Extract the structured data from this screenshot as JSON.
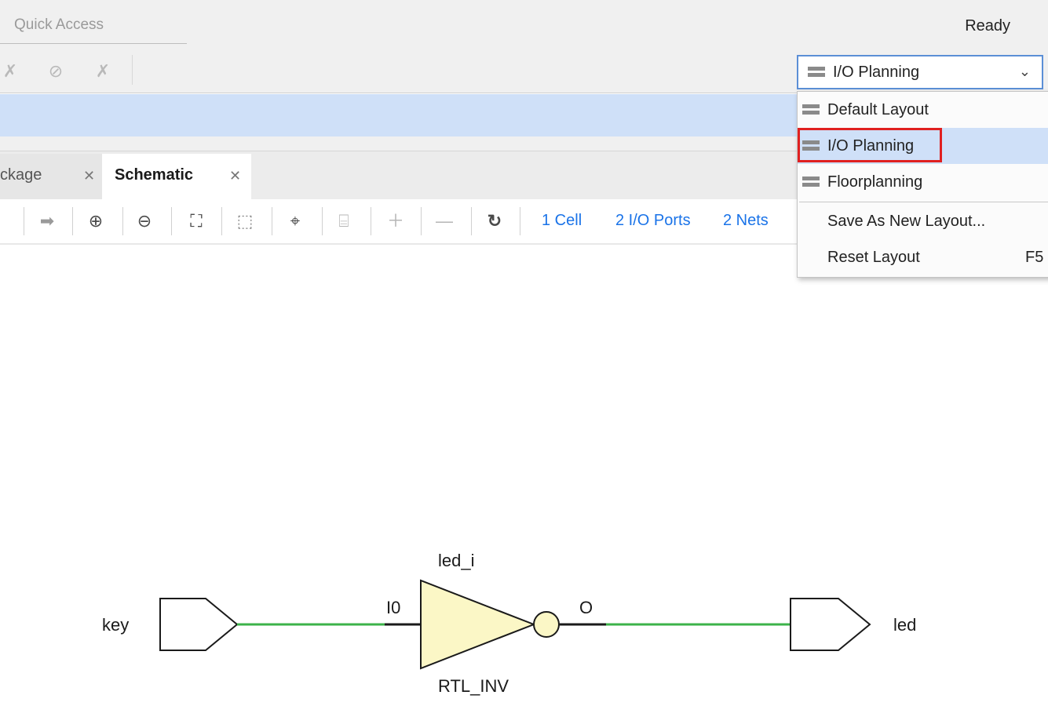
{
  "topbar": {
    "quick_access_placeholder": "Quick Access",
    "status": "Ready"
  },
  "layout_selector": {
    "selected": "I/O Planning",
    "menu": [
      {
        "label": "Default Layout"
      },
      {
        "label": "I/O Planning"
      },
      {
        "label": "Floorplanning"
      },
      {
        "label": "Save As New Layout..."
      },
      {
        "label": "Reset Layout",
        "shortcut": "F5"
      }
    ]
  },
  "tabs": [
    {
      "label": "ckage"
    },
    {
      "label": "Schematic"
    }
  ],
  "schematic_toolbar": {
    "links": [
      "1 Cell",
      "2 I/O Ports",
      "2 Nets"
    ]
  },
  "schematic": {
    "input_port": "key",
    "output_port": "led",
    "cell_name": "led_i",
    "cell_type": "RTL_INV",
    "input_pin": "I0",
    "output_pin": "O",
    "colors": {
      "wire": "#3cb34a",
      "cell_fill": "#fbf7c6"
    }
  }
}
